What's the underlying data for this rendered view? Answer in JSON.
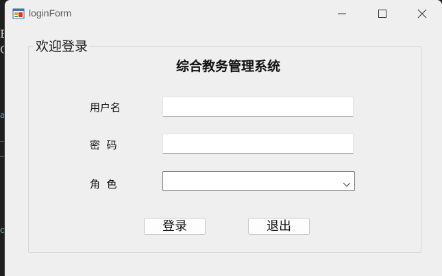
{
  "window": {
    "title": "loginForm",
    "icon": "winforms-app-icon",
    "controls": [
      "minimize-icon",
      "maximize-icon",
      "close-icon"
    ]
  },
  "form": {
    "group_title": "欢迎登录",
    "system_title": "综合教务管理系统",
    "username": {
      "label": "用户名",
      "value": ""
    },
    "password": {
      "label": "密  码",
      "value": ""
    },
    "role": {
      "label": "角  色",
      "selected": ""
    },
    "buttons": {
      "login": "登录",
      "exit": "退出"
    }
  },
  "background_fragments": [
    "F",
    "C",
    "a",
    "c"
  ],
  "colors": {
    "window_bg": "#efefef",
    "input_bg": "#ffffff",
    "desktop_bg": "#1f1f1f"
  }
}
